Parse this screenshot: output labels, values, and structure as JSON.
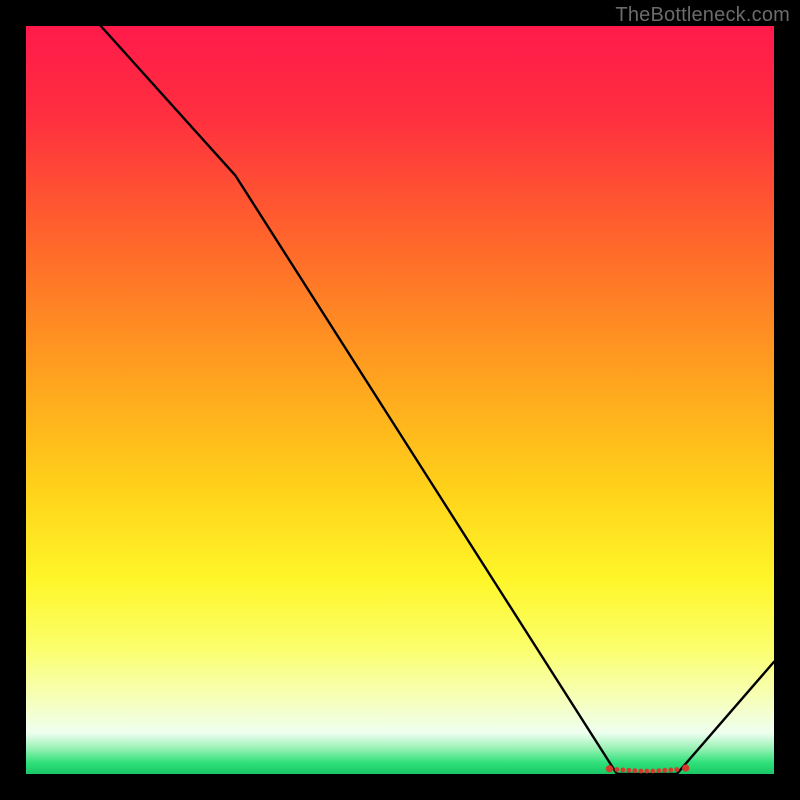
{
  "watermark": "TheBottleneck.com",
  "chart_data": {
    "type": "line",
    "title": "",
    "xlabel": "",
    "ylabel": "",
    "xlim": [
      0,
      100
    ],
    "ylim": [
      0,
      100
    ],
    "grid": false,
    "legend": false,
    "x": [
      10,
      28,
      79,
      87,
      100
    ],
    "values": [
      100,
      80,
      0,
      0,
      15
    ],
    "markers": {
      "x": [
        78,
        79,
        79.8,
        80.6,
        81.4,
        82.2,
        83,
        83.8,
        84.6,
        85.4,
        86.2,
        87,
        88.2
      ],
      "y": [
        0.7,
        0.6,
        0.55,
        0.5,
        0.45,
        0.4,
        0.4,
        0.4,
        0.45,
        0.5,
        0.55,
        0.6,
        0.8
      ]
    },
    "background_gradient_stops": [
      {
        "offset": 0.0,
        "color": "#ff1a4b"
      },
      {
        "offset": 0.12,
        "color": "#ff2f3f"
      },
      {
        "offset": 0.3,
        "color": "#ff6a2a"
      },
      {
        "offset": 0.48,
        "color": "#ffa61e"
      },
      {
        "offset": 0.62,
        "color": "#ffd21a"
      },
      {
        "offset": 0.74,
        "color": "#fff629"
      },
      {
        "offset": 0.83,
        "color": "#fbff6a"
      },
      {
        "offset": 0.9,
        "color": "#f6ffba"
      },
      {
        "offset": 0.945,
        "color": "#eefff0"
      },
      {
        "offset": 0.965,
        "color": "#9cf2b8"
      },
      {
        "offset": 0.985,
        "color": "#2fe07a"
      },
      {
        "offset": 1.0,
        "color": "#19c765"
      }
    ]
  }
}
